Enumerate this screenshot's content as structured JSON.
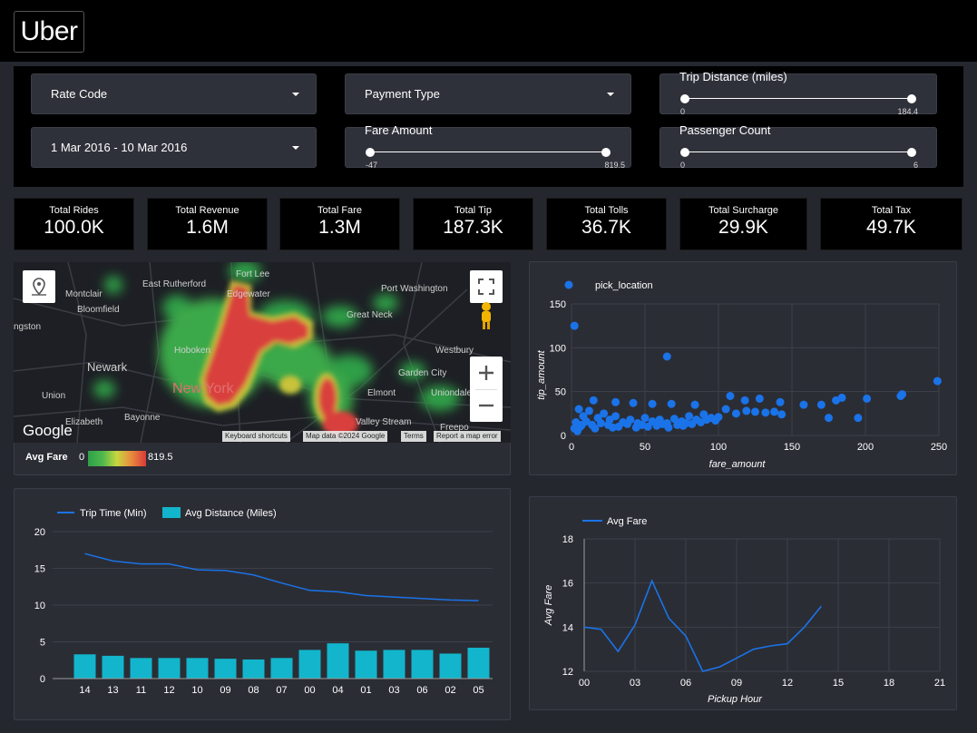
{
  "header": {
    "logo_text": "Uber"
  },
  "filters": {
    "rate_code": {
      "label": "Rate Code"
    },
    "payment_type": {
      "label": "Payment Type"
    },
    "date_range": {
      "label": "1 Mar 2016 - 10 Mar 2016"
    },
    "trip_distance": {
      "label": "Trip Distance (miles)",
      "min": "0",
      "max": "184.4"
    },
    "fare_amount": {
      "label": "Fare Amount",
      "min": "-47",
      "max": "819.5"
    },
    "passenger_count": {
      "label": "Passenger Count",
      "min": "0",
      "max": "6"
    }
  },
  "kpis": [
    {
      "label": "Total Rides",
      "value": "100.0K"
    },
    {
      "label": "Total Revenue",
      "value": "1.6M"
    },
    {
      "label": "Total Fare",
      "value": "1.3M"
    },
    {
      "label": "Total Tip",
      "value": "187.3K"
    },
    {
      "label": "Total Tolls",
      "value": "36.7K"
    },
    {
      "label": "Total Surcharge",
      "value": "29.9K"
    },
    {
      "label": "Total Tax",
      "value": "49.7K"
    }
  ],
  "map": {
    "places": [
      "Montclair",
      "East Rutherford",
      "Bloomfield",
      "Fort Lee",
      "Edgewater",
      "Port Washington",
      "Great Neck",
      "ngston",
      "Newark",
      "Hoboken",
      "New York",
      "Westbury",
      "Garden City",
      "Union",
      "Elmont",
      "Uniondale",
      "Elizabeth",
      "Bayonne",
      "Valley Stream",
      "Freepo"
    ],
    "google_label": "Google",
    "attribution": [
      "Keyboard shortcuts",
      "Map data ©2024 Google",
      "Terms",
      "Report a map error"
    ],
    "legend": {
      "label": "Avg Fare",
      "min": "0",
      "max": "819.5"
    }
  },
  "chart_data": [
    {
      "type": "scatter",
      "legend": [
        "pick_location"
      ],
      "xlabel": "fare_amount",
      "ylabel": "tip_amount",
      "xlim": [
        0,
        250
      ],
      "ylim": [
        0,
        150
      ],
      "xticks": [
        0,
        50,
        100,
        150,
        200,
        250
      ],
      "yticks": [
        0,
        50,
        100,
        150
      ],
      "series": [
        {
          "name": "pick_location",
          "color": "#1a73e8",
          "points": [
            [
              2,
              125
            ],
            [
              65,
              90
            ],
            [
              249,
              62
            ],
            [
              15,
              40
            ],
            [
              30,
              38
            ],
            [
              42,
              37
            ],
            [
              55,
              36
            ],
            [
              68,
              36
            ],
            [
              84,
              35
            ],
            [
              108,
              45
            ],
            [
              118,
              40
            ],
            [
              128,
              42
            ],
            [
              142,
              38
            ],
            [
              158,
              35
            ],
            [
              180,
              40
            ],
            [
              184,
              43
            ],
            [
              201,
              42
            ],
            [
              224,
              45
            ],
            [
              225,
              47
            ],
            [
              175,
              20
            ],
            [
              195,
              20
            ],
            [
              170,
              35
            ],
            [
              105,
              30
            ],
            [
              112,
              25
            ],
            [
              119,
              28
            ],
            [
              125,
              27
            ],
            [
              132,
              26
            ],
            [
              138,
              27
            ],
            [
              143,
              24
            ],
            [
              5,
              30
            ],
            [
              8,
              22
            ],
            [
              12,
              28
            ],
            [
              18,
              20
            ],
            [
              22,
              25
            ],
            [
              26,
              18
            ],
            [
              30,
              22
            ],
            [
              35,
              15
            ],
            [
              40,
              18
            ],
            [
              45,
              14
            ],
            [
              50,
              20
            ],
            [
              55,
              16
            ],
            [
              60,
              18
            ],
            [
              65,
              14
            ],
            [
              70,
              19
            ],
            [
              75,
              16
            ],
            [
              80,
              22
            ],
            [
              85,
              18
            ],
            [
              90,
              24
            ],
            [
              95,
              20
            ],
            [
              100,
              21
            ],
            [
              3,
              15
            ],
            [
              6,
              10
            ],
            [
              10,
              16
            ],
            [
              14,
              12
            ],
            [
              20,
              14
            ],
            [
              25,
              12
            ],
            [
              32,
              10
            ],
            [
              38,
              13
            ],
            [
              48,
              12
            ],
            [
              58,
              11
            ],
            [
              62,
              13
            ],
            [
              72,
              12
            ],
            [
              78,
              14
            ],
            [
              88,
              15
            ],
            [
              92,
              18
            ],
            [
              98,
              17
            ],
            [
              2,
              8
            ],
            [
              4,
              5
            ],
            [
              7,
              12
            ],
            [
              16,
              8
            ],
            [
              28,
              9
            ],
            [
              44,
              9
            ],
            [
              52,
              10
            ],
            [
              66,
              9
            ],
            [
              76,
              11
            ],
            [
              82,
              13
            ]
          ]
        }
      ]
    },
    {
      "type": "bar+line",
      "categories": [
        "14",
        "13",
        "11",
        "12",
        "10",
        "09",
        "08",
        "07",
        "00",
        "04",
        "01",
        "03",
        "06",
        "02",
        "05"
      ],
      "ylim": [
        0,
        20
      ],
      "yticks": [
        0,
        5,
        10,
        15,
        20
      ],
      "series": [
        {
          "name": "Trip Time (Min)",
          "type": "line",
          "color": "#1a73e8",
          "values": [
            17.0,
            16.0,
            15.6,
            15.6,
            14.8,
            14.7,
            14.1,
            13.0,
            12.0,
            11.8,
            11.3,
            11.1,
            10.9,
            10.7,
            10.6
          ]
        },
        {
          "name": "Avg Distance (Miles)",
          "type": "bar",
          "color": "#12b5cb",
          "values": [
            3.3,
            3.1,
            2.8,
            2.8,
            2.8,
            2.7,
            2.6,
            2.8,
            3.9,
            4.8,
            3.8,
            3.9,
            3.9,
            3.4,
            4.2
          ]
        }
      ]
    },
    {
      "type": "line",
      "legend": [
        "Avg Fare"
      ],
      "xlabel": "Pickup Hour",
      "ylabel": "Avg Fare",
      "xlim": [
        0,
        21
      ],
      "ylim": [
        12,
        18
      ],
      "xticks": [
        "00",
        "03",
        "06",
        "09",
        "12",
        "15",
        "18",
        "21"
      ],
      "yticks": [
        12,
        14,
        16,
        18
      ],
      "series": [
        {
          "name": "Avg Fare",
          "color": "#1a73e8",
          "x": [
            0,
            1,
            2,
            3,
            4,
            5,
            6,
            7,
            8,
            9,
            10,
            11,
            12,
            13,
            14
          ],
          "values": [
            14.0,
            13.9,
            12.9,
            14.1,
            16.1,
            14.4,
            13.6,
            12.0,
            12.2,
            12.6,
            13.0,
            13.15,
            13.25,
            14.0,
            14.95
          ]
        }
      ]
    }
  ]
}
